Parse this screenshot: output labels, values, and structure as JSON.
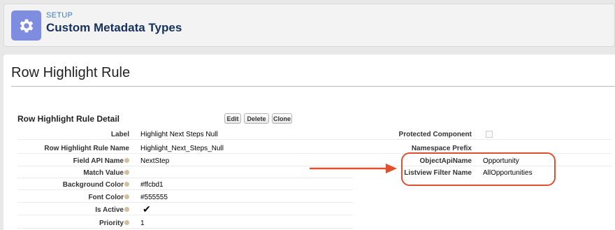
{
  "header": {
    "setup_label": "SETUP",
    "title": "Custom Metadata Types",
    "icon": "gear-icon",
    "icon_bg": "#7f8de1"
  },
  "page": {
    "title": "Row Highlight Rule"
  },
  "detail": {
    "section_title": "Row Highlight Rule Detail",
    "buttons": {
      "edit": "Edit",
      "delete": "Delete",
      "clone": "Clone"
    },
    "left_fields": [
      {
        "label": "Label",
        "value": "Highlight Next Steps Null"
      },
      {
        "label": "Row Highlight Rule Name",
        "value": "Highlight_Next_Steps_Null"
      },
      {
        "label": "Field API Name",
        "value": "NextStep"
      },
      {
        "label": "Match Value",
        "value": ""
      },
      {
        "label": "Background Color",
        "value": "#ffcbd1"
      },
      {
        "label": "Font Color",
        "value": "#555555"
      },
      {
        "label": "Is Active",
        "value": "✔"
      },
      {
        "label": "Priority",
        "value": "1"
      }
    ],
    "right_fields": [
      {
        "label": "Protected Component",
        "value": ""
      },
      {
        "label": "Namespace Prefix",
        "value": ""
      },
      {
        "label": "ObjectApiName",
        "value": "Opportunity"
      },
      {
        "label": "Listview Filter Name",
        "value": "AllOpportunities"
      }
    ]
  },
  "annotation": {
    "color": "#e0502f"
  }
}
